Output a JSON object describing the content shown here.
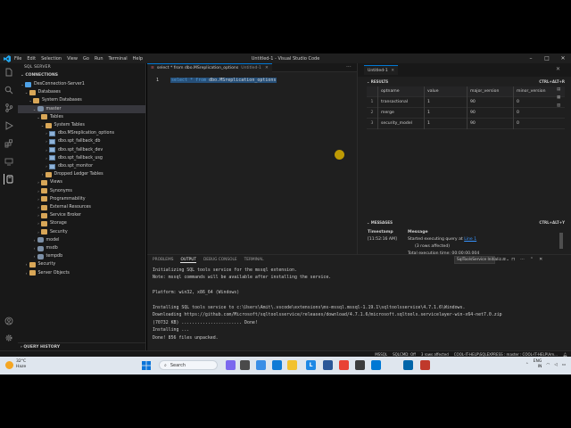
{
  "window": {
    "title": "Untitled-1 - Visual Studio Code",
    "menu": [
      "File",
      "Edit",
      "Selection",
      "View",
      "Go",
      "Run",
      "Terminal",
      "Help"
    ]
  },
  "sidebar": {
    "header": "SQL SERVER",
    "section": "CONNECTIONS",
    "tree": [
      {
        "label": "DesConnection-Server1",
        "level": 1,
        "icon": "server-icon",
        "chevron": "v"
      },
      {
        "label": "Databases",
        "level": 2,
        "icon": "folder-icon",
        "chevron": "v"
      },
      {
        "label": "System Databases",
        "level": 3,
        "icon": "folder-icon",
        "chevron": "v"
      },
      {
        "label": "master",
        "level": 4,
        "icon": "database-icon",
        "chevron": "v",
        "selected": true
      },
      {
        "label": "Tables",
        "level": 5,
        "icon": "folder-icon",
        "chevron": "v"
      },
      {
        "label": "System Tables",
        "level": 6,
        "icon": "folder-icon",
        "chevron": "v"
      },
      {
        "label": "dbo.MSreplication_options",
        "level": 7,
        "icon": "table-icon",
        "chevron": ">"
      },
      {
        "label": "dbo.spt_fallback_db",
        "level": 7,
        "icon": "table-icon",
        "chevron": ">"
      },
      {
        "label": "dbo.spt_fallback_dev",
        "level": 7,
        "icon": "table-icon",
        "chevron": ">"
      },
      {
        "label": "dbo.spt_fallback_usg",
        "level": 7,
        "icon": "table-icon",
        "chevron": ">"
      },
      {
        "label": "dbo.spt_monitor",
        "level": 7,
        "icon": "table-icon",
        "chevron": ">"
      },
      {
        "label": "Dropped Ledger Tables",
        "level": 6,
        "icon": "folder-icon",
        "chevron": ">"
      },
      {
        "label": "Views",
        "level": 5,
        "icon": "folder-icon",
        "chevron": ">"
      },
      {
        "label": "Synonyms",
        "level": 5,
        "icon": "folder-icon",
        "chevron": ">"
      },
      {
        "label": "Programmability",
        "level": 5,
        "icon": "folder-icon",
        "chevron": ">"
      },
      {
        "label": "External Resources",
        "level": 5,
        "icon": "folder-icon",
        "chevron": ">"
      },
      {
        "label": "Service Broker",
        "level": 5,
        "icon": "folder-icon",
        "chevron": ">"
      },
      {
        "label": "Storage",
        "level": 5,
        "icon": "folder-icon",
        "chevron": ">"
      },
      {
        "label": "Security",
        "level": 5,
        "icon": "folder-icon",
        "chevron": ">"
      },
      {
        "label": "model",
        "level": 4,
        "icon": "database-icon",
        "chevron": ">"
      },
      {
        "label": "msdb",
        "level": 4,
        "icon": "database-icon",
        "chevron": ">"
      },
      {
        "label": "tempdb",
        "level": 4,
        "icon": "database-icon",
        "chevron": ">"
      },
      {
        "label": "Security",
        "level": 2,
        "icon": "folder-icon",
        "chevron": ">"
      },
      {
        "label": "Server Objects",
        "level": 2,
        "icon": "folder-icon",
        "chevron": ">"
      }
    ],
    "query_history": "QUERY HISTORY"
  },
  "editor": {
    "tab_label": "select * from dbo.MSreplication_options",
    "tab_suffix": "Untitled-1",
    "line_number": "1",
    "code_keyword1": "select * from ",
    "code_ident": "dbo.MSreplication_options"
  },
  "results": {
    "tab_label": "Untitled-1",
    "results_header": "RESULTS",
    "results_shortcut": "CTRL+ALT+R",
    "columns": [
      "optname",
      "value",
      "major_version",
      "minor_version"
    ],
    "rows": [
      [
        "1",
        "transactional",
        "1",
        "90",
        "0"
      ],
      [
        "2",
        "merge",
        "1",
        "90",
        "0"
      ],
      [
        "3",
        "security_model",
        "1",
        "90",
        "0"
      ]
    ],
    "messages_header": "MESSAGES",
    "messages_shortcut": "CTRL+ALT+Y",
    "msg_col_timestamp": "Timestamp",
    "msg_col_message": "Message",
    "msg_time": "[11:52:16 AM]",
    "msg_text": "Started executing query at ",
    "msg_link": "Line 1",
    "msg_rows": "(3 rows affected)",
    "msg_total": "Total execution time: 00:00:00.004"
  },
  "panel": {
    "tabs": [
      "PROBLEMS",
      "OUTPUT",
      "DEBUG CONSOLE",
      "TERMINAL"
    ],
    "active_tab": "OUTPUT",
    "channel": "SqlToolsService Initializ...",
    "output_lines": [
      "Initializing SQL tools service for the mssql extension.",
      "Note: mssql commands will be available after installing the service.",
      "",
      "Platform: win32, x86_64 (Windows)",
      "",
      "Installing SQL tools service to c:\\Users\\Amit\\.vscode\\extensions\\ms-mssql.mssql-1.19.1\\sqltoolsservice\\4.7.1.6\\Windows.",
      "Downloading https://github.com/Microsoft/sqltoolsservice/releases/download/4.7.1.6/microsoft.sqltools.servicelayer-win-x64-net7.0.zip",
      "(70732 KB) ....................... Done!",
      "Installing ...",
      "Done! 856 files unpacked."
    ]
  },
  "status": {
    "items": [
      "MSSQL",
      "SQLCMD: Off",
      "3 rows affected",
      "COOL-IT-HELP\\SQLEXPRESS : master : COOL-IT-HELP\\Am..."
    ]
  },
  "taskbar": {
    "temp": "32°C",
    "weather": "Haze",
    "search": "Search",
    "lang1": "ENG",
    "lang2": "IN"
  }
}
